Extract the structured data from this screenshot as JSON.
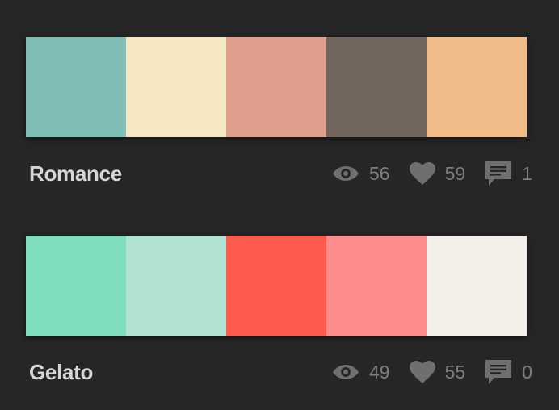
{
  "themes": [
    {
      "name": "Romance",
      "colors": [
        "#80bdb4",
        "#f6e8c0",
        "#e09e8d",
        "#71655d",
        "#efbb87"
      ],
      "views": "56",
      "likes": "59",
      "comments": "1"
    },
    {
      "name": "Gelato",
      "colors": [
        "#80ddbd",
        "#b0e3d4",
        "#fe5a4f",
        "#fe8b8b",
        "#f4eee8"
      ],
      "views": "49",
      "likes": "55",
      "comments": "0"
    }
  ],
  "icons": {
    "views": "eye-icon",
    "likes": "heart-icon",
    "comments": "comment-icon"
  }
}
